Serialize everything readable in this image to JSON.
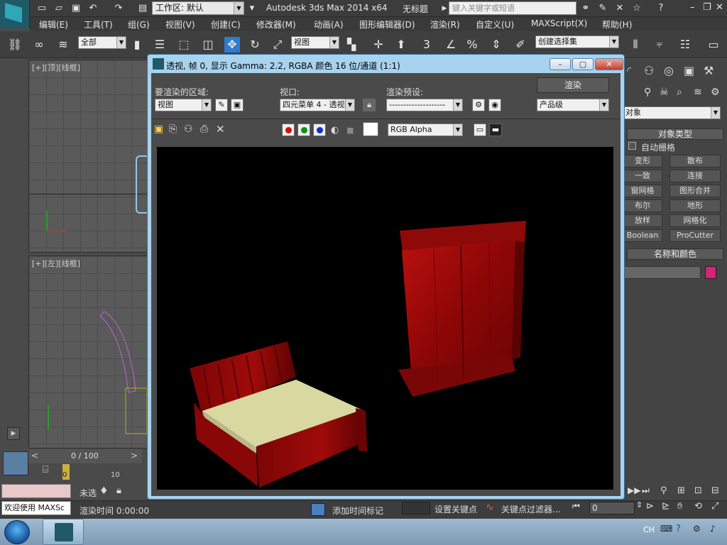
{
  "titlebar": {
    "workspace": "工作区: 默认",
    "app_title": "Autodesk 3ds Max  2014 x64",
    "doc_title": "无标题",
    "search_placeholder": "键入关键字或短语"
  },
  "menubar": {
    "items": [
      "编辑(E)",
      "工具(T)",
      "组(G)",
      "视图(V)",
      "创建(C)",
      "修改器(M)",
      "动画(A)",
      "图形编辑器(D)",
      "渲染(R)",
      "自定义(U)",
      "MAXScript(X)",
      "帮助(H)"
    ]
  },
  "toolbar": {
    "selection_filter": "全部",
    "ref_coord": "视图",
    "named_selection": "创建选择集",
    "snap_label": "3"
  },
  "viewports": {
    "top_label": "[+][顶][线框]",
    "left_label": "[+][左][线框]"
  },
  "render_window": {
    "title": "透视, 帧 0, 显示 Gamma: 2.2, RGBA 颜色 16 位/通道 (1:1)",
    "area_label": "要渲染的区域:",
    "area_value": "视图",
    "viewport_label": "视口:",
    "viewport_value": "四元菜单 4 - 透视",
    "preset_label": "渲染预设:",
    "preset_value": "--------------------",
    "render_button": "渲染",
    "quality_value": "产品级",
    "channel_value": "RGB Alpha"
  },
  "command_panel": {
    "object_dropdown": "对象",
    "rollout_object_type": "对象类型",
    "auto_grid": "自动栅格",
    "buttons": [
      "变形",
      "散布",
      "一致",
      "连接",
      "窗网格",
      "图形合并",
      "布尔",
      "地形",
      "放样",
      "网格化",
      "Boolean",
      "ProCutter"
    ],
    "rollout_name_color": "名称和颜色",
    "object_color": "#d4247a"
  },
  "timeline": {
    "frame": "0 / 100",
    "tick_0": "0",
    "tick_10": "10"
  },
  "status": {
    "welcome": "欢迎使用 MAXSc",
    "unselected": "未选",
    "render_time": "渲染时间  0:00:00",
    "add_time_tag": "添加时间标记",
    "set_key": "设置关键点",
    "key_filters": "关键点过滤器...",
    "frame_field": "0"
  },
  "taskbar": {
    "lang": "CH"
  }
}
